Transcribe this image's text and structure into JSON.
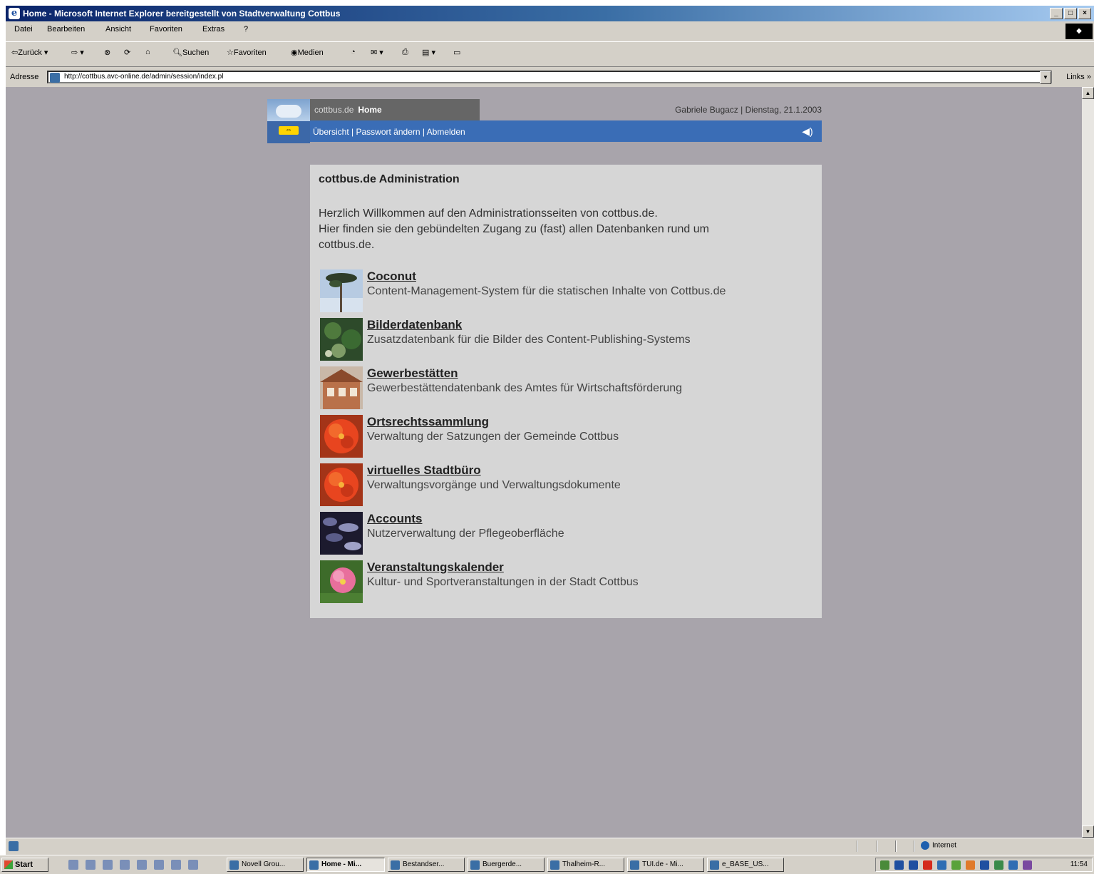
{
  "browser": {
    "title": "Home - Microsoft Internet Explorer bereitgestellt von Stadtverwaltung Cottbus",
    "menu": [
      "Datei",
      "Bearbeiten",
      "Ansicht",
      "Favoriten",
      "Extras",
      "?"
    ],
    "toolbar": {
      "back": "Zurück",
      "search": "Suchen",
      "favorites": "Favoriten",
      "media": "Medien"
    },
    "address_label": "Adresse",
    "url": "http://cottbus.avc-online.de/admin/session/index.pl",
    "links_label": "Links",
    "status_zone": "Internet"
  },
  "site": {
    "name": "cottbus.de",
    "page": "Home",
    "user_info": "Gabriele Bugacz | Dienstag, 21.1.2003",
    "nav": {
      "overview": "Übersicht",
      "sep1": " | ",
      "change_password": "Passwort ändern",
      "sep2": " | ",
      "logout": "Abmelden"
    }
  },
  "content": {
    "heading": "cottbus.de Administration",
    "intro_lines": [
      "Herzlich Willkommen auf den Administrationsseiten von cottbus.de.",
      "Hier finden sie den gebündelten Zugang zu (fast) allen Datenbanken rund um",
      "cottbus.de."
    ],
    "entries": [
      {
        "name": "Coconut",
        "description": "Content-Management-System für die statischen Inhalte von Cottbus.de"
      },
      {
        "name": "Bilderdatenbank",
        "description": "Zusatzdatenbank für die Bilder des Content-Publishing-Systems"
      },
      {
        "name": "Gewerbestätten",
        "description": "Gewerbestättendatenbank des Amtes für Wirtschaftsförderung"
      },
      {
        "name": "Ortsrechtssammlung",
        "description": "Verwaltung der Satzungen der Gemeinde Cottbus"
      },
      {
        "name": "virtuelles Stadtbüro",
        "description": "Verwaltungsvorgänge und Verwaltungsdokumente"
      },
      {
        "name": "Accounts",
        "description": "Nutzerverwaltung der Pflegeoberfläche"
      },
      {
        "name": "Veranstaltungskalender",
        "description": "Kultur- und Sportveranstaltungen in der Stadt Cottbus"
      }
    ]
  },
  "taskbar": {
    "start": "Start",
    "tasks": [
      "Novell Grou...",
      "Home - Mi...",
      "Bestandser...",
      "Buergerde...",
      "Thalheim-R...",
      "TUI.de - Mi...",
      "e_BASE_US..."
    ],
    "clock": "11:54"
  },
  "colors": {
    "viewport_bg": "#a8a4ab",
    "panel_bg": "#d6d6d6",
    "nav_blue": "#3a6db6",
    "home_gray": "#666666"
  }
}
